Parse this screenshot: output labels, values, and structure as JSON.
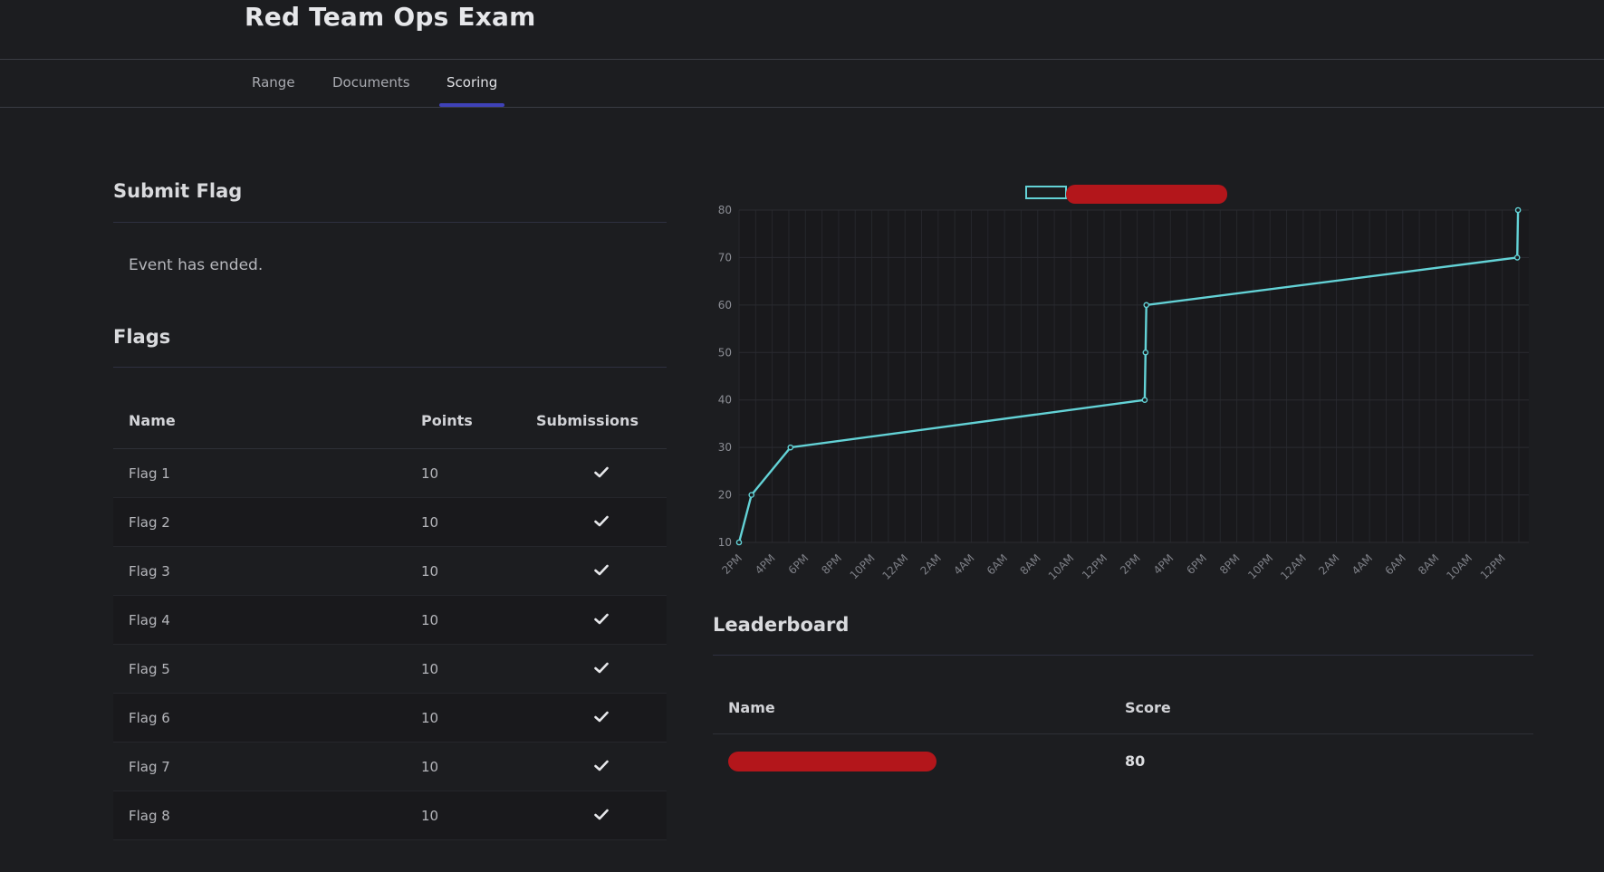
{
  "header": {
    "title": "Red Team Ops Exam"
  },
  "tabs": [
    {
      "label": "Range"
    },
    {
      "label": "Documents"
    },
    {
      "label": "Scoring",
      "active": true
    }
  ],
  "submit": {
    "title": "Submit Flag",
    "message": "Event has ended."
  },
  "flags": {
    "title": "Flags",
    "columns": [
      "Name",
      "Points",
      "Submissions"
    ],
    "rows": [
      {
        "name": "Flag 1",
        "points": "10",
        "submitted": true
      },
      {
        "name": "Flag 2",
        "points": "10",
        "submitted": true
      },
      {
        "name": "Flag 3",
        "points": "10",
        "submitted": true
      },
      {
        "name": "Flag 4",
        "points": "10",
        "submitted": true
      },
      {
        "name": "Flag 5",
        "points": "10",
        "submitted": true
      },
      {
        "name": "Flag 6",
        "points": "10",
        "submitted": true
      },
      {
        "name": "Flag 7",
        "points": "10",
        "submitted": true
      },
      {
        "name": "Flag 8",
        "points": "10",
        "submitted": true
      }
    ]
  },
  "chart_data": {
    "type": "line",
    "title": "",
    "xlabel": "",
    "ylabel": "",
    "legend": {
      "placement": "top-center",
      "label_redacted": true
    },
    "ylim": [
      10,
      80
    ],
    "yticks": [
      "10",
      "20",
      "30",
      "40",
      "50",
      "60",
      "70",
      "80"
    ],
    "xticks": [
      "2PM",
      "4PM",
      "6PM",
      "8PM",
      "10PM",
      "12AM",
      "2AM",
      "4AM",
      "6AM",
      "8AM",
      "10AM",
      "12PM",
      "2PM",
      "4PM",
      "6PM",
      "8PM",
      "10PM",
      "12AM",
      "2AM",
      "4AM",
      "6AM",
      "8AM",
      "10AM",
      "12PM"
    ],
    "grid": true,
    "series": [
      {
        "color": "#63d2d6",
        "points": [
          {
            "x": 0.0,
            "y": 10
          },
          {
            "x": 0.75,
            "y": 20
          },
          {
            "x": 3.1,
            "y": 30
          },
          {
            "x": 24.45,
            "y": 40
          },
          {
            "x": 24.5,
            "y": 50
          },
          {
            "x": 24.55,
            "y": 60
          },
          {
            "x": 46.9,
            "y": 70
          },
          {
            "x": 46.95,
            "y": 80
          }
        ]
      }
    ]
  },
  "leaderboard": {
    "title": "Leaderboard",
    "columns": [
      "Name",
      "Score"
    ],
    "rows": [
      {
        "name_redacted": true,
        "score": "80"
      }
    ]
  },
  "colors": {
    "accent": "#3f42b8",
    "line": "#63d2d6",
    "redaction": "#b3161b",
    "background": "#1c1d20"
  },
  "icons": {
    "submission": "check-icon"
  }
}
